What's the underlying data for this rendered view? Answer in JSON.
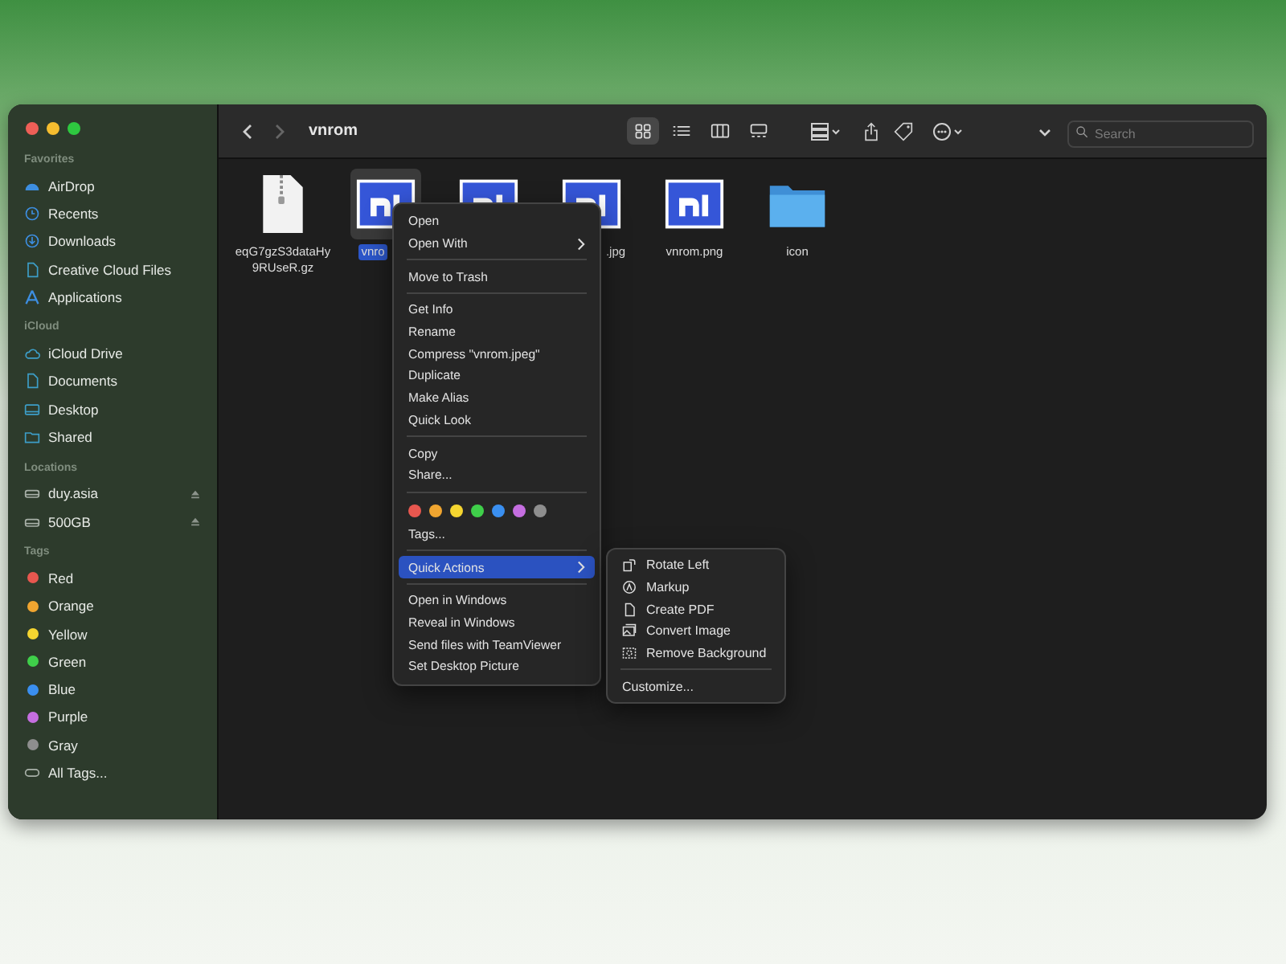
{
  "window": {
    "title": "vnrom"
  },
  "sidebar": {
    "sections": [
      {
        "header": "Favorites",
        "items": [
          {
            "label": "AirDrop"
          },
          {
            "label": "Recents"
          },
          {
            "label": "Downloads"
          },
          {
            "label": "Creative Cloud Files"
          },
          {
            "label": "Applications"
          }
        ]
      },
      {
        "header": "iCloud",
        "items": [
          {
            "label": "iCloud Drive"
          },
          {
            "label": "Documents"
          },
          {
            "label": "Desktop"
          },
          {
            "label": "Shared"
          }
        ]
      },
      {
        "header": "Locations",
        "items": [
          {
            "label": "duy.asia",
            "eject": true
          },
          {
            "label": "500GB",
            "eject": true
          }
        ]
      },
      {
        "header": "Tags",
        "items": [
          {
            "label": "Red",
            "color": "#e8574f"
          },
          {
            "label": "Orange",
            "color": "#f0a530"
          },
          {
            "label": "Yellow",
            "color": "#f5d530"
          },
          {
            "label": "Green",
            "color": "#3fcf4a"
          },
          {
            "label": "Blue",
            "color": "#3a8ff0"
          },
          {
            "label": "Purple",
            "color": "#c56ee0"
          },
          {
            "label": "Gray",
            "color": "#8e8e8e"
          },
          {
            "label": "All Tags..."
          }
        ]
      }
    ]
  },
  "toolbar": {
    "search": {
      "placeholder": "Search"
    },
    "views": [
      {
        "kind": "icons",
        "selected": true
      },
      {
        "kind": "list",
        "selected": false
      },
      {
        "kind": "columns",
        "selected": false
      },
      {
        "kind": "gallery",
        "selected": false
      }
    ]
  },
  "files": [
    {
      "name": "eqG7gzS3dataHy9RUseR.gz",
      "kind": "archive",
      "selected": false
    },
    {
      "name": "vnro",
      "kind": "image",
      "selected": true
    },
    {
      "kind": "image",
      "selected": false
    },
    {
      "name": ".jpg",
      "kind": "image",
      "selected": false
    },
    {
      "name": "vnrom.png",
      "kind": "image",
      "selected": false
    },
    {
      "name": "icon",
      "kind": "folder",
      "selected": false
    }
  ],
  "context_menu": {
    "groups": [
      {
        "items": [
          {
            "kind": "action",
            "label": "Open",
            "submenu": false,
            "selected": false
          },
          {
            "kind": "action",
            "label": "Open With",
            "submenu": true,
            "selected": false
          }
        ]
      },
      {
        "items": [
          {
            "kind": "action",
            "label": "Move to Trash",
            "submenu": false,
            "selected": false
          }
        ]
      },
      {
        "items": [
          {
            "kind": "action",
            "label": "Get Info",
            "submenu": false,
            "selected": false
          },
          {
            "kind": "action",
            "label": "Rename",
            "submenu": false,
            "selected": false
          },
          {
            "kind": "action",
            "label": "Compress \"vnrom.jpeg\"",
            "submenu": false,
            "selected": false
          },
          {
            "kind": "action",
            "label": "Duplicate",
            "submenu": false,
            "selected": false
          },
          {
            "kind": "action",
            "label": "Make Alias",
            "submenu": false,
            "selected": false
          },
          {
            "kind": "action",
            "label": "Quick Look",
            "submenu": false,
            "selected": false
          }
        ]
      },
      {
        "items": [
          {
            "kind": "action",
            "label": "Copy",
            "submenu": false,
            "selected": false
          },
          {
            "kind": "action",
            "label": "Share...",
            "submenu": false,
            "selected": false
          }
        ]
      },
      {
        "items": [
          {
            "kind": "colors",
            "colors": [
              {
                "color": "#e8574f"
              },
              {
                "color": "#f0a530"
              },
              {
                "color": "#f5d530"
              },
              {
                "color": "#3fcf4a"
              },
              {
                "color": "#3a8ff0"
              },
              {
                "color": "#c56ee0"
              },
              {
                "color": "#8e8e8e"
              }
            ]
          },
          {
            "kind": "action",
            "label": "Tags...",
            "submenu": false,
            "selected": false
          }
        ]
      },
      {
        "items": [
          {
            "kind": "action",
            "label": "Quick Actions",
            "submenu": true,
            "selected": true
          }
        ]
      },
      {
        "items": [
          {
            "kind": "action",
            "label": "Open in Windows",
            "submenu": false,
            "selected": false
          },
          {
            "kind": "action",
            "label": "Reveal in Windows",
            "submenu": false,
            "selected": false
          },
          {
            "kind": "action",
            "label": "Send files with TeamViewer",
            "submenu": false,
            "selected": false
          },
          {
            "kind": "action",
            "label": "Set Desktop Picture",
            "submenu": false,
            "selected": false
          }
        ]
      }
    ]
  },
  "submenu": {
    "items": [
      {
        "label": "Rotate Left"
      },
      {
        "label": "Markup"
      },
      {
        "label": "Create PDF"
      },
      {
        "label": "Convert Image"
      },
      {
        "label": "Remove Background"
      }
    ],
    "footer": "Customize..."
  }
}
